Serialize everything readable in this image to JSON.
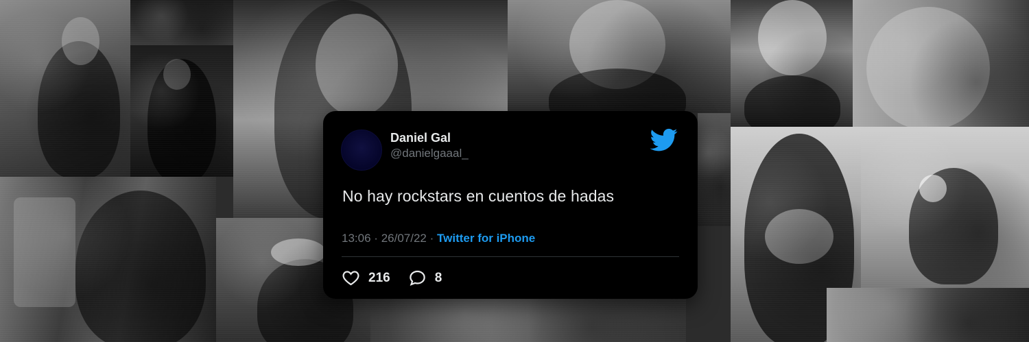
{
  "banner": {
    "photos": [
      {
        "name": "photo-top-left"
      },
      {
        "name": "photo-left-guitar"
      },
      {
        "name": "photo-left-slot-machine"
      },
      {
        "name": "photo-center-hood"
      },
      {
        "name": "photo-center-bottle"
      },
      {
        "name": "photo-right-mask"
      },
      {
        "name": "photo-right-shirtless"
      },
      {
        "name": "photo-right-cat"
      },
      {
        "name": "photo-right-couch"
      },
      {
        "name": "photo-bottom-cowboy"
      },
      {
        "name": "photo-bottom-center"
      }
    ]
  },
  "tweet": {
    "display_name": "Daniel Gal",
    "handle": "@danielgaaal_",
    "text": "No hay rockstars en cuentos de hadas",
    "time": "13:06",
    "separator": "·",
    "date": "26/07/22",
    "source": "Twitter for iPhone",
    "likes": "216",
    "replies": "8",
    "brand_color": "#1d9bf0",
    "like_icon": "heart-icon",
    "reply_icon": "speech-bubble-icon",
    "logo_icon": "twitter-bird-icon"
  }
}
